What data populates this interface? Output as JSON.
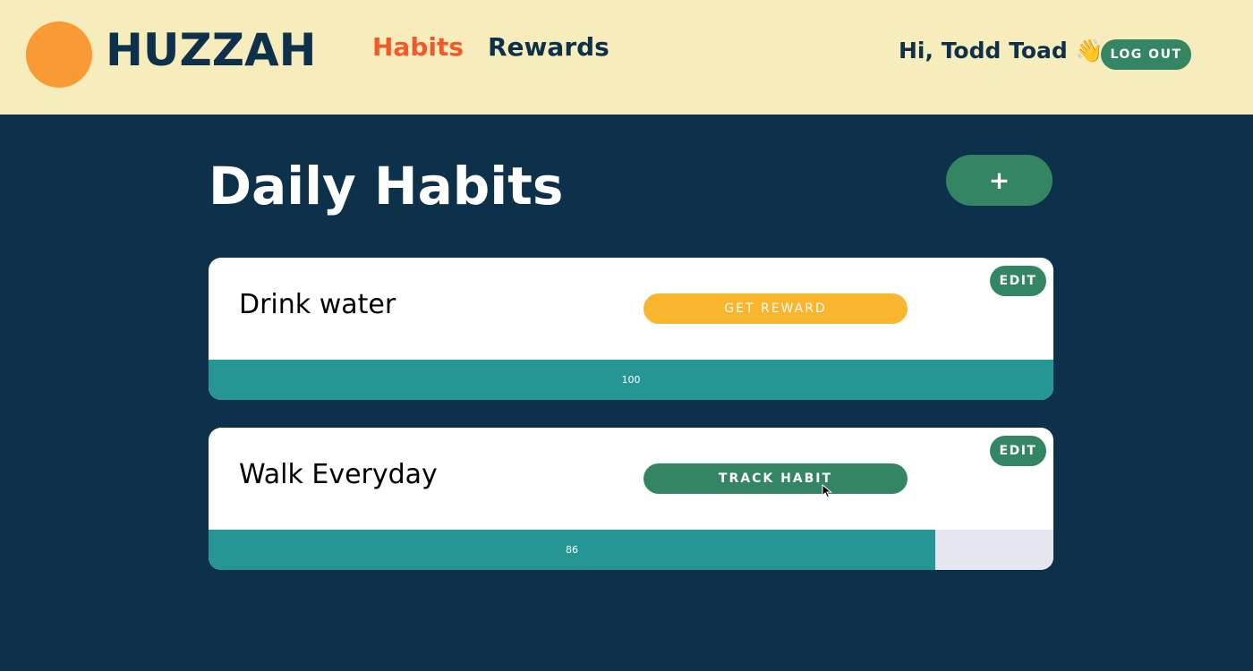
{
  "header": {
    "brand": "HUZZAH",
    "nav": [
      {
        "label": "Habits",
        "active": true
      },
      {
        "label": "Rewards",
        "active": false
      }
    ],
    "greeting": "Hi, Todd Toad 👋",
    "logout_label": "LOG OUT",
    "colors": {
      "background": "#f7ecbb",
      "logo": "#fa9a35",
      "active_nav": "#f2592a",
      "text": "#0e314b",
      "button": "#338564"
    }
  },
  "main": {
    "title": "Daily Habits",
    "add_label": "+",
    "habits": [
      {
        "name": "Drink water",
        "edit_label": "EDIT",
        "action_label": "GET REWARD",
        "action_color": "#f9b52d",
        "progress": 100,
        "progress_label": "100"
      },
      {
        "name": "Walk Everyday",
        "edit_label": "EDIT",
        "action_label": "TRACK HABIT",
        "action_color": "#338564",
        "progress": 86,
        "progress_label": "86"
      }
    ],
    "colors": {
      "background": "#0e314b",
      "progress_fill": "#269695",
      "progress_track": "#e6e6f0"
    }
  }
}
